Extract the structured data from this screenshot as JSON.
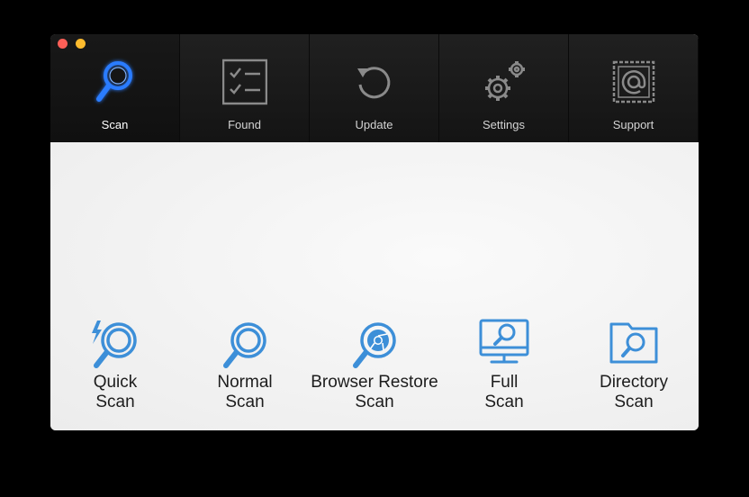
{
  "window": {
    "controls": [
      "close",
      "minimize"
    ]
  },
  "toolbar": {
    "tabs": [
      {
        "label": "Scan",
        "icon": "magnifier-glow-icon",
        "active": true
      },
      {
        "label": "Found",
        "icon": "checklist-icon",
        "active": false
      },
      {
        "label": "Update",
        "icon": "refresh-icon",
        "active": false
      },
      {
        "label": "Settings",
        "icon": "gears-icon",
        "active": false
      },
      {
        "label": "Support",
        "icon": "at-stamp-icon",
        "active": false
      }
    ]
  },
  "scan_options": [
    {
      "line1": "Quick",
      "line2": "Scan",
      "icon": "quick-scan-icon"
    },
    {
      "line1": "Normal",
      "line2": "Scan",
      "icon": "normal-scan-icon"
    },
    {
      "line1": "Browser Restore",
      "line2": "Scan",
      "icon": "browser-scan-icon"
    },
    {
      "line1": "Full",
      "line2": "Scan",
      "icon": "full-scan-icon"
    },
    {
      "line1": "Directory",
      "line2": "Scan",
      "icon": "directory-scan-icon"
    }
  ],
  "colors": {
    "accent": "#3d8fd8",
    "active_glow": "#1f6dff",
    "toolbar_bg": "#1a1a1a",
    "content_bg": "#f1f1f1"
  }
}
